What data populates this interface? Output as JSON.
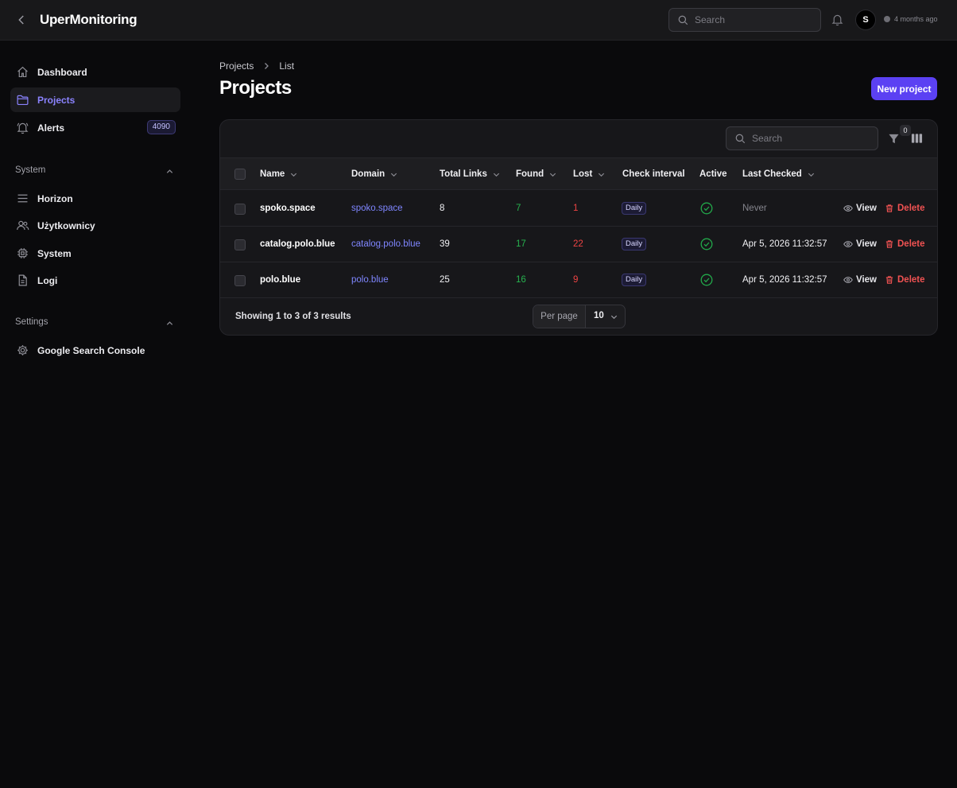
{
  "app": {
    "title": "UperMonitoring",
    "search_placeholder": "Search",
    "avatar_initial": "S",
    "last_update": "4 months ago"
  },
  "sidebar": {
    "items": [
      {
        "label": "Dashboard",
        "icon": "home-icon"
      },
      {
        "label": "Projects",
        "icon": "folder-icon",
        "active": true
      },
      {
        "label": "Alerts",
        "icon": "bell-icon",
        "badge": "4090"
      }
    ],
    "groups": [
      {
        "label": "System",
        "items": [
          {
            "label": "Horizon",
            "icon": "server-icon"
          },
          {
            "label": "Użytkownicy",
            "icon": "users-icon"
          },
          {
            "label": "System",
            "icon": "cpu-chip-icon"
          },
          {
            "label": "Logi",
            "icon": "document-icon"
          }
        ]
      },
      {
        "label": "Settings",
        "items": [
          {
            "label": "Google Search Console",
            "icon": "gear-icon"
          }
        ]
      }
    ]
  },
  "breadcrumb": [
    "Projects",
    "List"
  ],
  "page": {
    "title": "Projects",
    "new_button": "New project"
  },
  "table": {
    "search_placeholder": "Search",
    "filter_count": "0",
    "columns": [
      "Name",
      "Domain",
      "Total Links",
      "Found",
      "Lost",
      "Check interval",
      "Active",
      "Last Checked"
    ],
    "rows": [
      {
        "name": "spoko.space",
        "domain": "spoko.space",
        "total": "8",
        "found": "7",
        "lost": "1",
        "interval": "Daily",
        "active": true,
        "last_checked": "Never"
      },
      {
        "name": "catalog.polo.blue",
        "domain": "catalog.polo.blue",
        "total": "39",
        "found": "17",
        "lost": "22",
        "interval": "Daily",
        "active": true,
        "last_checked": "Apr 5, 2026 11:32:57"
      },
      {
        "name": "polo.blue",
        "domain": "polo.blue",
        "total": "25",
        "found": "16",
        "lost": "9",
        "interval": "Daily",
        "active": true,
        "last_checked": "Apr 5, 2026 11:32:57"
      }
    ],
    "row_actions": {
      "view": "View",
      "delete": "Delete"
    },
    "footer": {
      "summary": "Showing 1 to 3 of 3 results",
      "per_page_label": "Per page",
      "per_page_value": "10"
    }
  },
  "colors": {
    "accent": "#5b41f3",
    "link": "#7f86ff",
    "found": "#27b34f",
    "lost": "#ef4444",
    "active": "#22a84a"
  }
}
